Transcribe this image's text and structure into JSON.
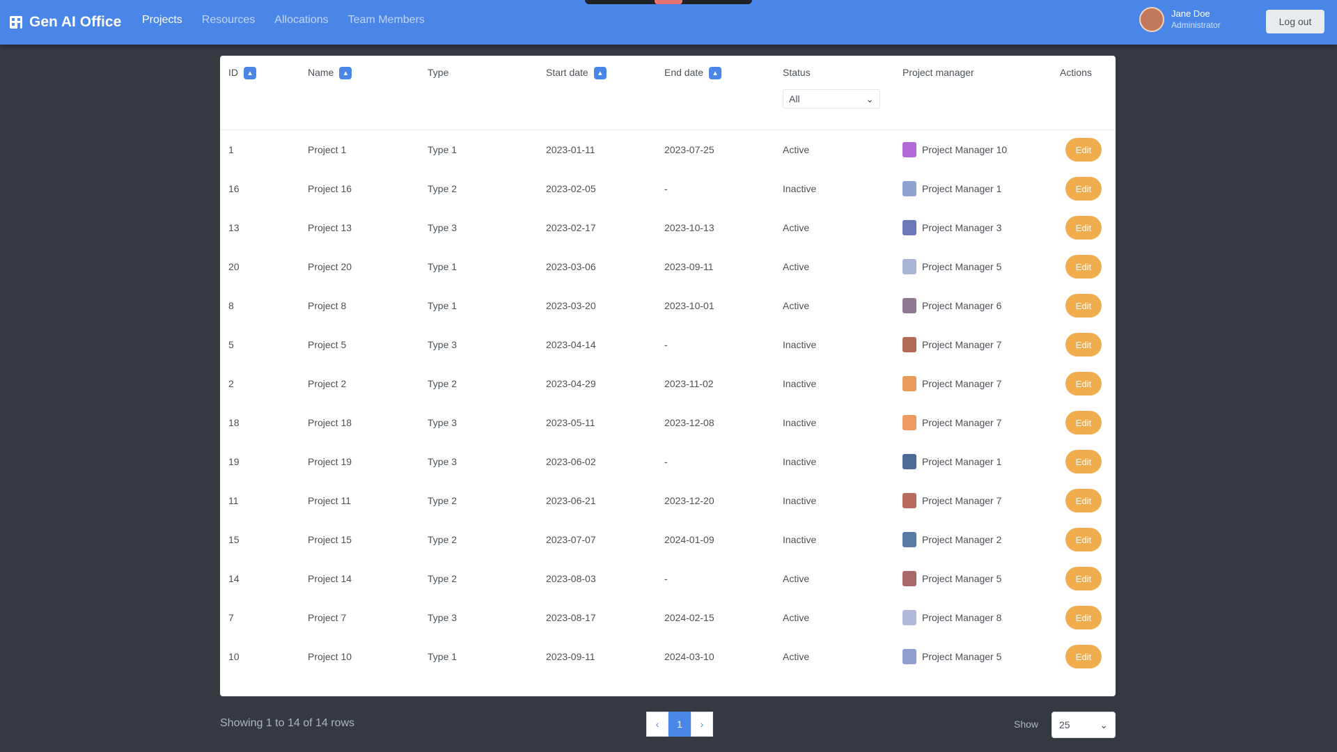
{
  "navbar": {
    "brand": "Gen AI Office",
    "links": [
      "Projects",
      "Resources",
      "Allocations",
      "Team Members"
    ]
  },
  "user": {
    "name": "Jane Doe",
    "role": "Administrator"
  },
  "logout_label": "Log out",
  "table": {
    "headers": {
      "id": "ID",
      "name": "Name",
      "type": "Type",
      "start": "Start date",
      "end": "End date",
      "status": "Status",
      "pm": "Project manager",
      "actions": "Actions"
    },
    "sort_icon": "sort-icon",
    "status_filter": "All",
    "edit_label": "Edit",
    "rows": [
      {
        "id": "1",
        "name": "Project 1",
        "type": "Type 1",
        "start": "2023-01-11",
        "end": "2023-07-25",
        "status": "Active",
        "pm": "Project Manager 10",
        "pm_color": "#b06bd6"
      },
      {
        "id": "16",
        "name": "Project 16",
        "type": "Type 2",
        "start": "2023-02-05",
        "end": "-",
        "status": "Inactive",
        "pm": "Project Manager 1",
        "pm_color": "#8fa3d1"
      },
      {
        "id": "13",
        "name": "Project 13",
        "type": "Type 3",
        "start": "2023-02-17",
        "end": "2023-10-13",
        "status": "Active",
        "pm": "Project Manager 3",
        "pm_color": "#6b78b8"
      },
      {
        "id": "20",
        "name": "Project 20",
        "type": "Type 1",
        "start": "2023-03-06",
        "end": "2023-09-11",
        "status": "Active",
        "pm": "Project Manager 5",
        "pm_color": "#a9b4d6"
      },
      {
        "id": "8",
        "name": "Project 8",
        "type": "Type 1",
        "start": "2023-03-20",
        "end": "2023-10-01",
        "status": "Active",
        "pm": "Project Manager 6",
        "pm_color": "#8f7890"
      },
      {
        "id": "5",
        "name": "Project 5",
        "type": "Type 3",
        "start": "2023-04-14",
        "end": "-",
        "status": "Inactive",
        "pm": "Project Manager 7",
        "pm_color": "#b06a55"
      },
      {
        "id": "2",
        "name": "Project 2",
        "type": "Type 2",
        "start": "2023-04-29",
        "end": "2023-11-02",
        "status": "Inactive",
        "pm": "Project Manager 7",
        "pm_color": "#e89a5a"
      },
      {
        "id": "18",
        "name": "Project 18",
        "type": "Type 3",
        "start": "2023-05-11",
        "end": "2023-12-08",
        "status": "Inactive",
        "pm": "Project Manager 7",
        "pm_color": "#ef9a60"
      },
      {
        "id": "19",
        "name": "Project 19",
        "type": "Type 3",
        "start": "2023-06-02",
        "end": "-",
        "status": "Inactive",
        "pm": "Project Manager 1",
        "pm_color": "#4d6a96"
      },
      {
        "id": "11",
        "name": "Project 11",
        "type": "Type 2",
        "start": "2023-06-21",
        "end": "2023-12-20",
        "status": "Inactive",
        "pm": "Project Manager 7",
        "pm_color": "#b86a5c"
      },
      {
        "id": "15",
        "name": "Project 15",
        "type": "Type 2",
        "start": "2023-07-07",
        "end": "2024-01-09",
        "status": "Inactive",
        "pm": "Project Manager 2",
        "pm_color": "#5a7aa6"
      },
      {
        "id": "14",
        "name": "Project 14",
        "type": "Type 2",
        "start": "2023-08-03",
        "end": "-",
        "status": "Active",
        "pm": "Project Manager 5",
        "pm_color": "#a86a68"
      },
      {
        "id": "7",
        "name": "Project 7",
        "type": "Type 3",
        "start": "2023-08-17",
        "end": "2024-02-15",
        "status": "Active",
        "pm": "Project Manager 8",
        "pm_color": "#b1b8d8"
      },
      {
        "id": "10",
        "name": "Project 10",
        "type": "Type 1",
        "start": "2023-09-11",
        "end": "2024-03-10",
        "status": "Active",
        "pm": "Project Manager 5",
        "pm_color": "#8fa0d0"
      }
    ]
  },
  "footer": {
    "showing": "Showing 1 to 14 of 14 rows",
    "pages": [
      "‹",
      "1",
      "›"
    ],
    "active_page": "1",
    "show_label": "Show",
    "page_size": "25"
  }
}
